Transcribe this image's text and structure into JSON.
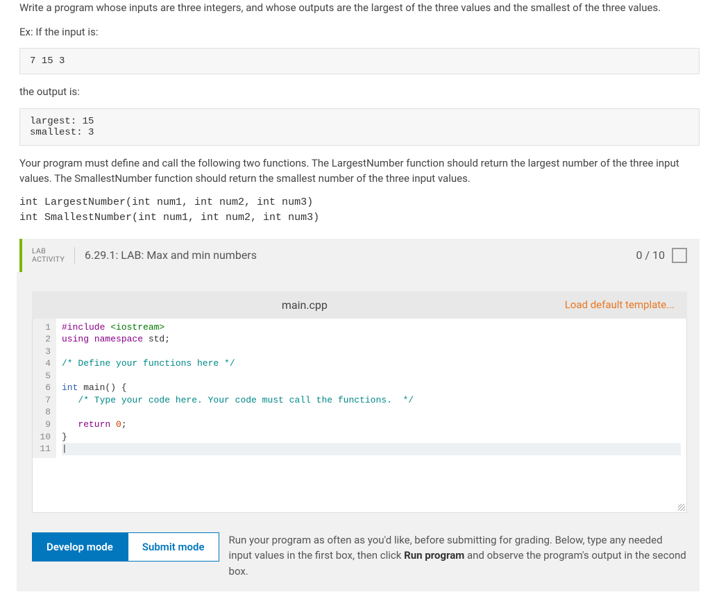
{
  "problem": {
    "intro": "Write a program whose inputs are three integers, and whose outputs are the largest of the three values and the smallest of the three values.",
    "example_label": "Ex: If the input is:",
    "example_input": "7 15 3",
    "output_label": "the output is:",
    "example_output": "largest: 15\nsmallest: 3",
    "requirements": "Your program must define and call the following two functions. The LargestNumber function should return the largest number of the three input values. The SmallestNumber function should return the smallest number of the three input values.",
    "signature1": "int LargestNumber(int num1, int num2, int num3)",
    "signature2": "int SmallestNumber(int num1, int num2, int num3)"
  },
  "lab": {
    "badge_line1": "LAB",
    "badge_line2": "ACTIVITY",
    "title": "6.29.1: LAB: Max and min numbers",
    "score": "0 / 10",
    "filename": "main.cpp",
    "load_template": "Load default template...",
    "code": {
      "lines": [
        "1",
        "2",
        "3",
        "4",
        "5",
        "6",
        "7",
        "8",
        "9",
        "10",
        "11"
      ],
      "l1_inc": "#include",
      "l1_hdr": " <iostream>",
      "l2_kw1": "using",
      "l2_kw2": " namespace",
      "l2_rest": " std;",
      "l4_cmt": "/* Define your functions here */",
      "l6_type": "int",
      "l6_rest": " main() {",
      "l7_cmt": "   /* Type your code here. Your code must call the functions.  */",
      "l9_kw": "   return",
      "l9_num": " 0",
      "l9_end": ";",
      "l10": "}"
    },
    "buttons": {
      "develop": "Develop mode",
      "submit": "Submit mode"
    },
    "mode_desc_pre": "Run your program as often as you'd like, before submitting for grading. Below, type any needed input values in the first box, then click ",
    "mode_desc_bold": "Run program",
    "mode_desc_post": " and observe the program's output in the second box."
  }
}
